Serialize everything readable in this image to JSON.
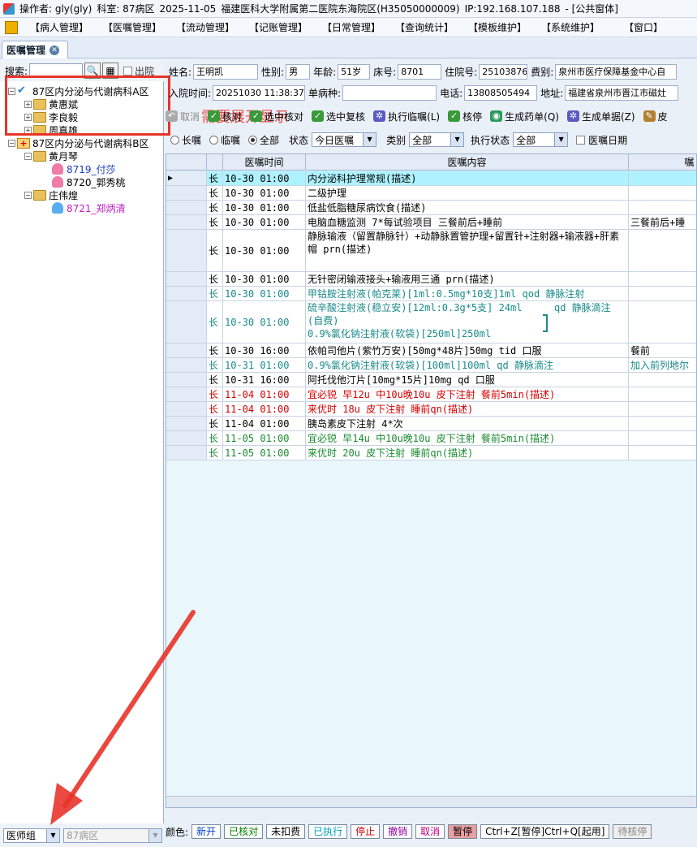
{
  "title_bar": {
    "operator": "操作者: gly(gly)",
    "department": "科室: 87病区",
    "date": "2025-11-05",
    "hospital": "福建医科大学附属第二医院东海院区(H35050000009)",
    "ip": "IP:192.168.107.188",
    "window": "- [公共窗体]"
  },
  "menu": [
    "【病人管理】",
    "【医嘱管理】",
    "【流动管理】",
    "【记账管理】",
    "【日常管理】",
    "【查询统计】",
    "【模板维护】",
    "【系统维护】",
    "【窗口】"
  ],
  "module_tab": "医嘱管理",
  "search": {
    "label": "搜索:",
    "value": "",
    "discharge_label": "出院"
  },
  "tree": {
    "ward_a": "87区内分泌与代谢病科A区",
    "doctors_a": [
      "黄惠斌",
      "李良毅",
      "周真雄"
    ],
    "ward_b": "87区内分泌与代谢病科B区",
    "doctor_b1": "黄月琴",
    "patients_b1": [
      "8719_付莎",
      "8720_郭秀桃"
    ],
    "doctor_b2": "庄伟煌",
    "patients_b2": [
      "8721_郑炳清"
    ]
  },
  "annotation": "需要展开显示",
  "left_bottom": {
    "group": "医师组",
    "ward": "87病区"
  },
  "patient": {
    "name_label": "姓名:",
    "name": "王明凯",
    "sex_label": "性别:",
    "sex": "男",
    "age_label": "年龄:",
    "age": "51岁",
    "bed_label": "床号:",
    "bed": "8701",
    "admit_no_label": "住院号:",
    "admit_no": "25103876",
    "fee_label": "费别:",
    "fee": "泉州市医疗保障基金中心自",
    "admit_time_label": "入院时间:",
    "admit_time": "20251030 11:38:37",
    "disease_label": "单病种:",
    "disease": "",
    "phone_label": "电话:",
    "phone": "13808505494",
    "address_label": "地址:",
    "address": "福建省泉州市晋江市磁灶"
  },
  "toolbar": [
    {
      "label": "取消",
      "icon": "undo-icon",
      "disabled": true
    },
    {
      "label": "核对",
      "icon": "check-icon",
      "disabled": false
    },
    {
      "label": "选中核对",
      "icon": "check-icon",
      "disabled": false
    },
    {
      "label": "选中复核",
      "icon": "check-icon",
      "disabled": false
    },
    {
      "label": "执行临嘱(L)",
      "icon": "gear-icon",
      "disabled": false
    },
    {
      "label": "核停",
      "icon": "check-icon",
      "disabled": false
    },
    {
      "label": "生成药单(Q)",
      "icon": "pill-icon",
      "disabled": false
    },
    {
      "label": "生成单据(Z)",
      "icon": "gear-icon",
      "disabled": false
    },
    {
      "label": "皮",
      "icon": "pen-icon",
      "disabled": false
    }
  ],
  "filter": {
    "long": "长嘱",
    "temp": "临嘱",
    "all": "全部",
    "status_label": "状态",
    "status": "今日医嘱",
    "type_label": "类别",
    "type": "全部",
    "exec_label": "执行状态",
    "exec": "全部",
    "date_label": "医嘱日期"
  },
  "grid": {
    "headers": [
      "医嘱时间",
      "医嘱内容",
      "嘱"
    ],
    "rows": [
      {
        "kind": "长",
        "time": "10-30 01:00",
        "content": "内分泌科护理常规(描述)",
        "extra": "",
        "color": "#000000",
        "bg": "#aef2ff",
        "lines": 1,
        "current": true
      },
      {
        "kind": "长",
        "time": "10-30 01:00",
        "content": "二级护理",
        "extra": "",
        "color": "#000000",
        "bg": "#ffffff",
        "lines": 1
      },
      {
        "kind": "长",
        "time": "10-30 01:00",
        "content": "低盐低脂糖尿病饮食(描述)",
        "extra": "",
        "color": "#000000",
        "bg": "#ffffff",
        "lines": 1
      },
      {
        "kind": "长",
        "time": "10-30 01:00",
        "content": "电脑血糖监测  7*每试验项目 三餐前后+睡前",
        "extra": "三餐前后+睡",
        "color": "#000000",
        "bg": "#ffffff",
        "lines": 1
      },
      {
        "kind": "长",
        "time": "10-30 01:00",
        "content": "静脉输液（留置静脉针）+动静脉置管护理+留置针+注射器+输液器+肝素帽 prn(描述)",
        "extra": "",
        "color": "#000000",
        "bg": "#ffffff",
        "lines": 3
      },
      {
        "kind": "长",
        "time": "10-30 01:00",
        "content": "无针密闭输液接头+输液用三通  prn(描述)",
        "extra": "",
        "color": "#000000",
        "bg": "#ffffff",
        "lines": 1
      },
      {
        "kind": "长",
        "time": "10-30 01:00",
        "content": "甲钴胺注射液(帕克莱)[1ml:0.5mg*10支]1ml qod 静脉注射",
        "extra": "",
        "color": "#1a8a8a",
        "bg": "#ffffff",
        "lines": 1
      },
      {
        "kind": "长",
        "time": "10-30 01:00",
        "content": "硫辛酸注射液(稳立安)[12ml:0.3g*5支] 24ml(自费)",
        "content2": "0.9%氯化钠注射液(软袋)[250ml]250ml",
        "side": "qd 静脉滴注",
        "extra": "",
        "color": "#1a8a8a",
        "bg": "#ffffff",
        "lines": 3,
        "group": true
      },
      {
        "kind": "长",
        "time": "10-30 16:00",
        "content": "依帕司他片(紫竹万安)[50mg*48片]50mg  tid 口服",
        "extra": "餐前",
        "color": "#000000",
        "bg": "#ffffff",
        "lines": 1
      },
      {
        "kind": "长",
        "time": "10-31 01:00",
        "content": "0.9%氯化钠注射液(软袋)[100ml]100ml  qd 静脉滴注",
        "extra": "加入前列地尔",
        "color": "#1a8a8a",
        "bg": "#ffffff",
        "lines": 1
      },
      {
        "kind": "长",
        "time": "10-31 16:00",
        "content": "阿托伐他汀片[10mg*15片]10mg  qd 口服",
        "extra": "",
        "color": "#000000",
        "bg": "#ffffff",
        "lines": 1
      },
      {
        "kind": "长",
        "time": "11-04 01:00",
        "content": "宜必锐 早12u 中10u晚10u 皮下注射 餐前5min(描述)",
        "extra": "",
        "color": "#d40000",
        "bg": "#ffffff",
        "lines": 1
      },
      {
        "kind": "长",
        "time": "11-04 01:00",
        "content": "来优时 18u 皮下注射 睡前qn(描述)",
        "extra": "",
        "color": "#d40000",
        "bg": "#ffffff",
        "lines": 1
      },
      {
        "kind": "长",
        "time": "11-04 01:00",
        "content": "胰岛素皮下注射  4*次",
        "extra": "",
        "color": "#000000",
        "bg": "#ffffff",
        "lines": 1
      },
      {
        "kind": "长",
        "time": "11-05 01:00",
        "content": "宜必锐 早14u 中10u晚10u 皮下注射 餐前5min(描述)",
        "extra": "",
        "color": "#1a8a30",
        "bg": "#ffffff",
        "lines": 1
      },
      {
        "kind": "长",
        "time": "11-05 01:00",
        "content": "来优时 20u 皮下注射 睡前qn(描述)",
        "extra": "",
        "color": "#1a8a30",
        "bg": "#ffffff",
        "lines": 1
      }
    ]
  },
  "legend": {
    "label": "颜色:",
    "items": [
      {
        "text": "新开",
        "color": "#0040c0",
        "bg": "#ffffff"
      },
      {
        "text": "已核对",
        "color": "#008000",
        "bg": "#ffffff"
      },
      {
        "text": "未扣费",
        "color": "#000000",
        "bg": "#ffffff"
      },
      {
        "text": "已执行",
        "color": "#00a0c0",
        "bg": "#ffffff"
      },
      {
        "text": "停止",
        "color": "#d00000",
        "bg": "#ffffff"
      },
      {
        "text": "撤销",
        "color": "#9000a0",
        "bg": "#ffffff"
      },
      {
        "text": "取消",
        "color": "#c00080",
        "bg": "#ffffff"
      },
      {
        "text": "暂停",
        "color": "#000000",
        "bg": "#e8a0a0"
      },
      {
        "text": "Ctrl+Z[暂停]Ctrl+Q[起用]",
        "color": "#000000",
        "bg": "#ffffff"
      },
      {
        "text": "待核停",
        "color": "#888888",
        "bg": "#eeeeee"
      }
    ]
  },
  "colors": {
    "annotation": "#e8342b",
    "accent": "#2a7bd0"
  }
}
